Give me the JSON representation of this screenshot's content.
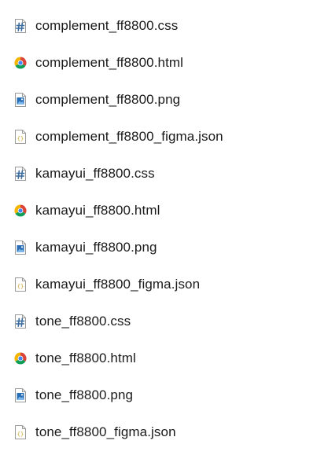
{
  "files": [
    {
      "name": "complement_ff8800.css",
      "icon": "css-file-icon"
    },
    {
      "name": "complement_ff8800.html",
      "icon": "chrome-html-icon"
    },
    {
      "name": "complement_ff8800.png",
      "icon": "image-file-icon"
    },
    {
      "name": "complement_ff8800_figma.json",
      "icon": "json-file-icon"
    },
    {
      "name": "kamayui_ff8800.css",
      "icon": "css-file-icon"
    },
    {
      "name": "kamayui_ff8800.html",
      "icon": "chrome-html-icon"
    },
    {
      "name": "kamayui_ff8800.png",
      "icon": "image-file-icon"
    },
    {
      "name": "kamayui_ff8800_figma.json",
      "icon": "json-file-icon"
    },
    {
      "name": "tone_ff8800.css",
      "icon": "css-file-icon"
    },
    {
      "name": "tone_ff8800.html",
      "icon": "chrome-html-icon"
    },
    {
      "name": "tone_ff8800.png",
      "icon": "image-file-icon"
    },
    {
      "name": "tone_ff8800_figma.json",
      "icon": "json-file-icon"
    }
  ],
  "colors": {
    "text": "#1a1a1a",
    "css_hash": "#3d6d9e",
    "json_braces": "#c9a227",
    "image_blue": "#2a6fb5",
    "chrome_red": "#db4437",
    "chrome_yellow": "#f4b400",
    "chrome_green": "#0f9d58",
    "chrome_blue": "#4285f4"
  }
}
